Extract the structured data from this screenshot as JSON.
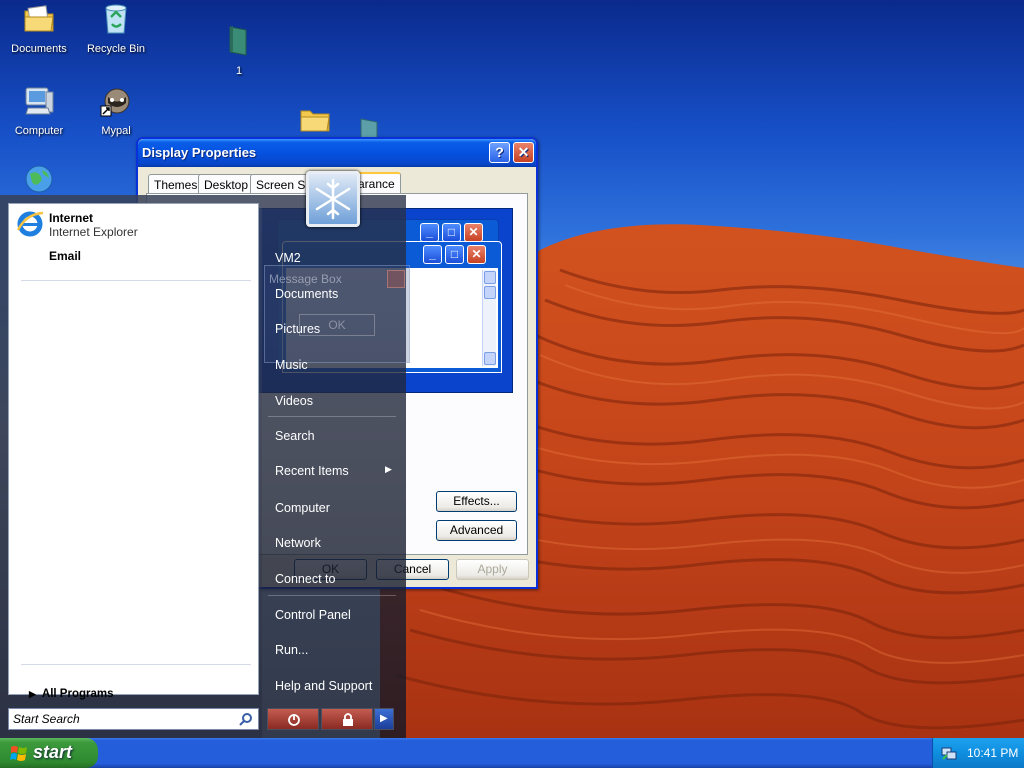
{
  "desktop": {
    "icons": [
      {
        "label": "Documents"
      },
      {
        "label": "Recycle Bin"
      },
      {
        "label": "1"
      },
      {
        "label": "Computer"
      },
      {
        "label": "Mypal"
      }
    ]
  },
  "display_properties": {
    "title": "Display Properties",
    "tabs": [
      "Themes",
      "Desktop",
      "Screen Sa",
      "arance"
    ],
    "preview_message_box": "Message Box",
    "preview_ok": "OK",
    "effects_button": "Effects...",
    "advanced_button": "Advanced",
    "ok_button": "OK",
    "cancel_button": "Cancel",
    "apply_button": "Apply"
  },
  "start_menu": {
    "pinned": [
      {
        "title": "Internet",
        "subtitle": "Internet Explorer",
        "icon": "ie-icon"
      },
      {
        "title": "Email",
        "subtitle": ""
      }
    ],
    "all_programs": "All Programs",
    "search_placeholder": "Start Search",
    "right_items": [
      "VM2",
      "Documents",
      "Pictures",
      "Music",
      "Videos",
      "Search",
      "Recent Items",
      "Computer",
      "Network",
      "Connect to",
      "Control Panel",
      "Run...",
      "Help and Support"
    ]
  },
  "taskbar": {
    "start_label": "start",
    "clock": "10:41 PM"
  },
  "colors": {
    "taskbar_blue": "#245edb",
    "start_green": "#3c9a3c",
    "title_blue": "#0551e0"
  }
}
